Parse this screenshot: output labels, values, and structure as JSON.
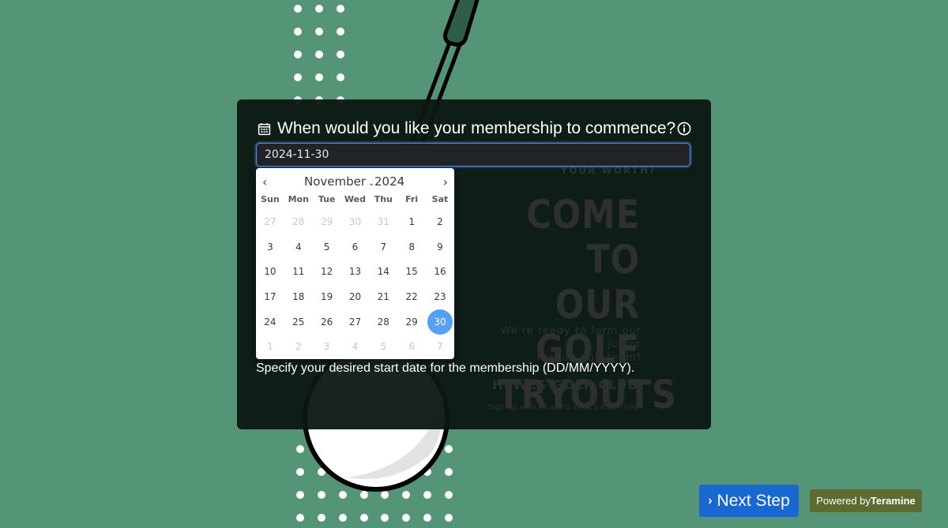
{
  "colors": {
    "background": "#559577",
    "card": "#0c1612",
    "accent": "#1968d2",
    "selected_day": "#569ff7",
    "powered_badge": "#5e6b30"
  },
  "question": {
    "icon": "calendar-icon",
    "text": "When would you like your membership to commence?",
    "info_icon": "info-icon"
  },
  "date_field": {
    "value": "2024-11-30"
  },
  "calendar": {
    "prev_label": "‹",
    "next_label": "›",
    "month": "November",
    "year": "2024",
    "weekdays": [
      "Sun",
      "Mon",
      "Tue",
      "Wed",
      "Thu",
      "Fri",
      "Sat"
    ],
    "days": [
      {
        "label": "27",
        "muted": true
      },
      {
        "label": "28",
        "muted": true
      },
      {
        "label": "29",
        "muted": true
      },
      {
        "label": "30",
        "muted": true
      },
      {
        "label": "31",
        "muted": true
      },
      {
        "label": "1"
      },
      {
        "label": "2"
      },
      {
        "label": "3"
      },
      {
        "label": "4"
      },
      {
        "label": "5"
      },
      {
        "label": "6"
      },
      {
        "label": "7"
      },
      {
        "label": "8"
      },
      {
        "label": "9"
      },
      {
        "label": "10"
      },
      {
        "label": "11"
      },
      {
        "label": "12"
      },
      {
        "label": "13"
      },
      {
        "label": "14"
      },
      {
        "label": "15"
      },
      {
        "label": "16"
      },
      {
        "label": "17"
      },
      {
        "label": "18"
      },
      {
        "label": "19"
      },
      {
        "label": "20"
      },
      {
        "label": "21"
      },
      {
        "label": "22"
      },
      {
        "label": "23"
      },
      {
        "label": "24"
      },
      {
        "label": "25"
      },
      {
        "label": "26"
      },
      {
        "label": "27"
      },
      {
        "label": "28"
      },
      {
        "label": "29"
      },
      {
        "label": "30",
        "selected": true
      },
      {
        "label": "1",
        "muted": true
      },
      {
        "label": "2",
        "muted": true
      },
      {
        "label": "3",
        "muted": true
      },
      {
        "label": "4",
        "muted": true
      },
      {
        "label": "5",
        "muted": true
      },
      {
        "label": "6",
        "muted": true
      },
      {
        "label": "7",
        "muted": true
      }
    ]
  },
  "helper_text": "Specify your desired start date for the membership (DD/MM/YYYY).",
  "poster": {
    "worth": "YOUR WORTH?",
    "headline": [
      "COME TO",
      "OUR GOLF",
      "TRYOUTS"
    ],
    "ready": [
      "We're ready to form our junior",
      "league golf team!"
    ],
    "club": "HEWES GOLF CLUB",
    "signup": "Sign up with Howard at 123-456-7890"
  },
  "footer": {
    "next_icon": "›",
    "next_label": "Next Step",
    "powered_prefix": "Powered by",
    "powered_brand": "Teramine"
  }
}
